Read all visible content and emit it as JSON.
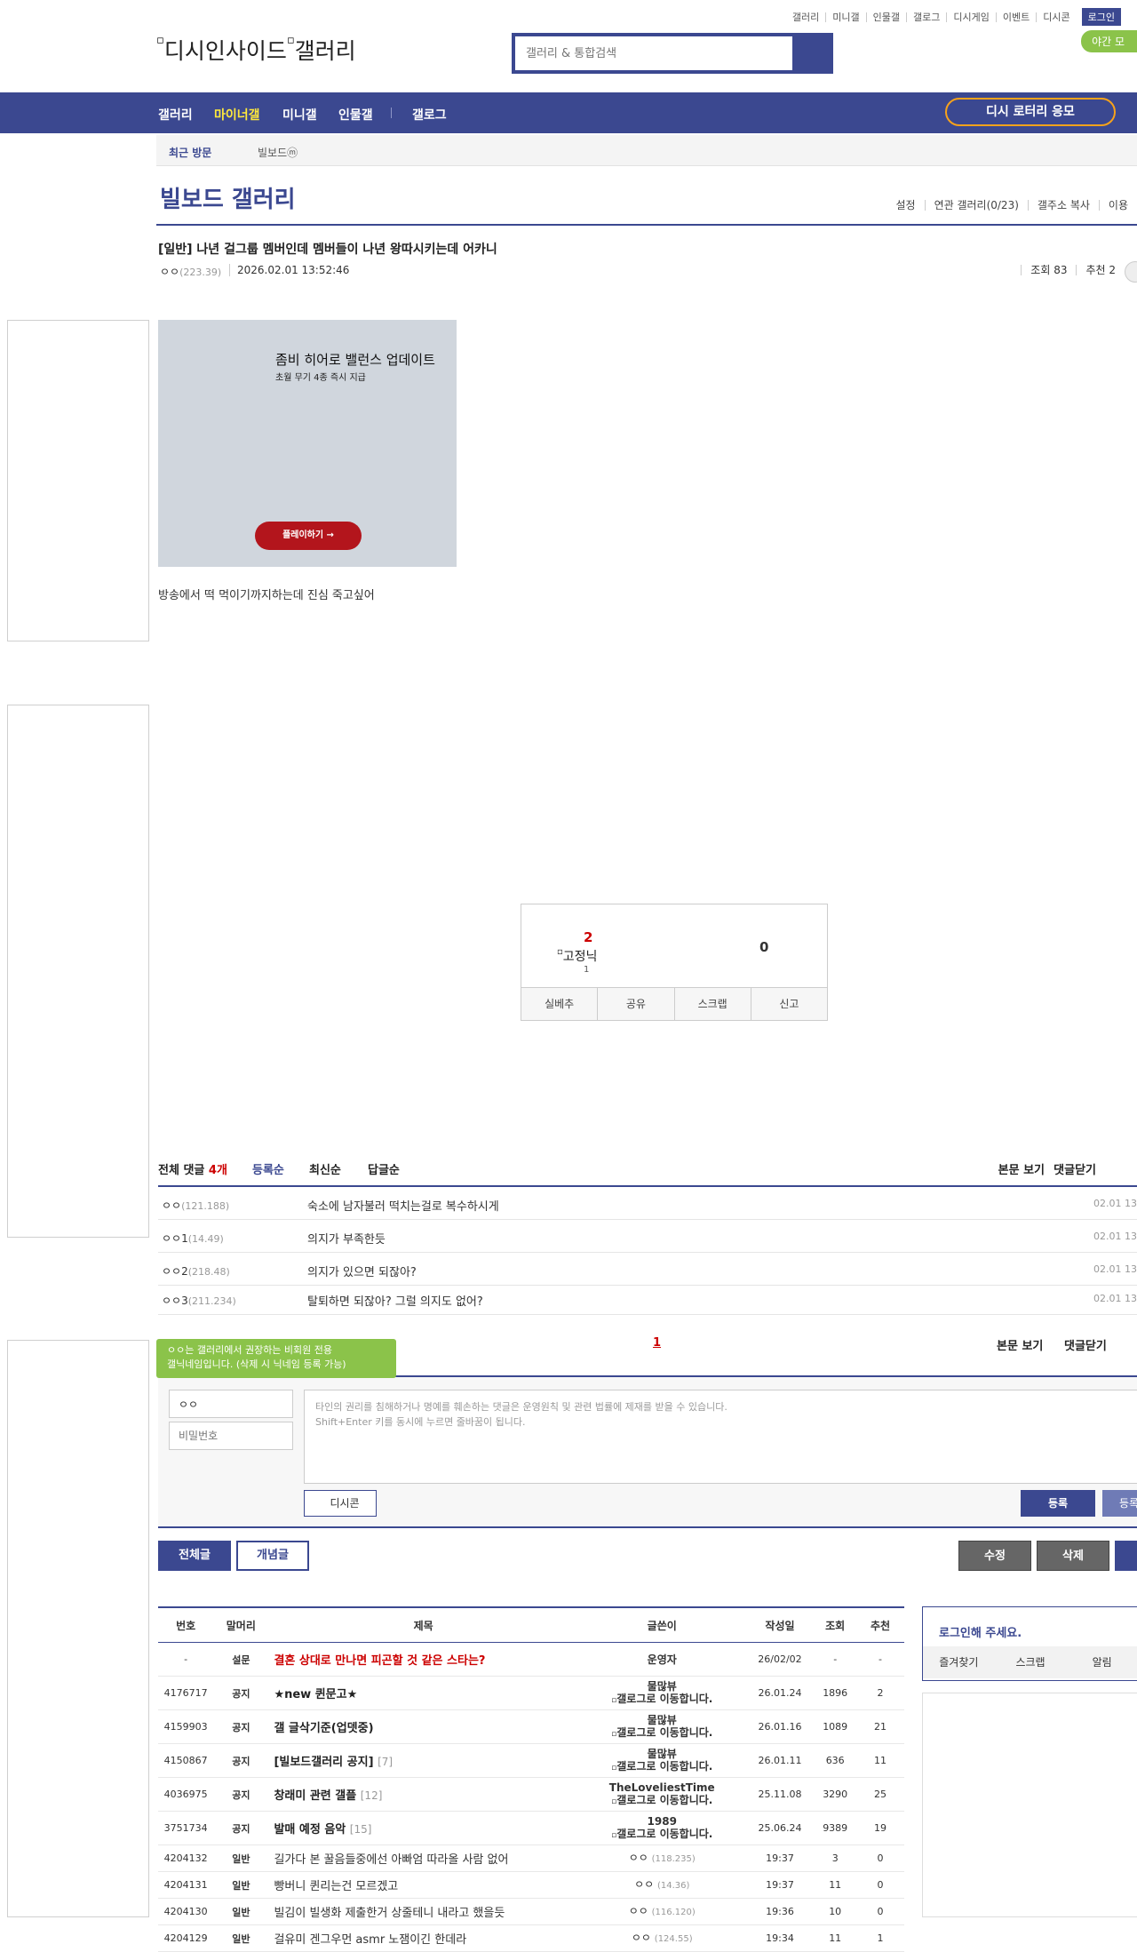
{
  "top_links": [
    "갤러리",
    "미니갤",
    "인물갤",
    "갤로그",
    "디시게임",
    "이벤트",
    "디시콘"
  ],
  "login_label": "로그인",
  "night_mode_label": "야간 모",
  "logo": {
    "alt1": "디시인사이드",
    "alt2": "갤러리"
  },
  "search": {
    "placeholder": "갤러리 & 통합검색"
  },
  "nav": {
    "items": [
      "갤러리",
      "마이너갤",
      "미니갤",
      "인물갤",
      "갤로그"
    ],
    "active_index": 1,
    "lotto": "디시 로터리 응모"
  },
  "recent": {
    "label": "최근 방문",
    "item": "빌보드ⓜ"
  },
  "gallery": {
    "title": "빌보드 갤러리",
    "tools": [
      "설정",
      "연관 갤러리(0/23)",
      "갤주소 복사",
      "이용"
    ]
  },
  "post": {
    "title": "[일반] 나년 걸그룹 멤버인데 멤버들이 나년 왕따시키는데 어카니",
    "writer": "ㅇㅇ",
    "writer_ip": "(223.39)",
    "date": "2026.02.01 13:52:46",
    "views": "조회 83",
    "recommends": "추천 2",
    "body": "방송에서 떡 먹이기까지하는데 진심 죽고싶어"
  },
  "ad": {
    "title": "좀비 히어로 밸런스 업데이트",
    "subtitle": "초월 무기 4종 즉시 지급",
    "button": "플레이하기 →"
  },
  "recommend_box": {
    "up_count": "2",
    "fix_alt": "고정닉",
    "fix_count": "1",
    "down_count": "0",
    "actions": [
      "실베추",
      "공유",
      "스크랩",
      "신고"
    ]
  },
  "comments": {
    "total_label": "전체 댓글",
    "count": "4개",
    "sort": [
      "등록순",
      "최신순",
      "답글순"
    ],
    "view_label": "본문 보기",
    "close_label": "댓글닫기",
    "items": [
      {
        "writer": "ㅇㅇ",
        "ip": "(121.188)",
        "text": "숙소에 남자불러 떡치는걸로 복수하시게",
        "date": "02.01 13"
      },
      {
        "writer": "ㅇㅇ1",
        "ip": "(14.49)",
        "text": "의지가 부족한듯",
        "date": "02.01 13"
      },
      {
        "writer": "ㅇㅇ2",
        "ip": "(218.48)",
        "text": "의지가 있으면 되잖아?",
        "date": "02.01 13"
      },
      {
        "writer": "ㅇㅇ3",
        "ip": "(211.234)",
        "text": "탈퇴하면 되잖아? 그럴 의지도 없어?",
        "date": "02.01 13"
      }
    ],
    "page": "1"
  },
  "write": {
    "tooltip_line1": "ㅇㅇ는 갤러리에서 권장하는 비회원 전용",
    "tooltip_line2": "갤닉네임입니다. (삭제 시 닉네임 등록 가능)",
    "nick": "ㅇㅇ",
    "password_placeholder": "비밀번호",
    "notice_line1": "타인의 권리를 침해하거나 명예를 훼손하는 댓글은 운영원칙 및 관련 법률에 제재를 받을 수 있습니다.",
    "notice_line2": "Shift+Enter 키를 동시에 누르면 줄바꿈이 됩니다.",
    "dccon": "디시콘",
    "submit": "등록",
    "submit2": "등록"
  },
  "list_buttons": {
    "all": "전체글",
    "concept": "개념글",
    "edit": "수정",
    "delete": "삭제"
  },
  "table": {
    "headers": [
      "번호",
      "말머리",
      "제목",
      "글쓴이",
      "작성일",
      "조회",
      "추천"
    ],
    "rows": [
      {
        "no": "-",
        "head": "설문",
        "subject": "결혼 상대로 만나면 피곤할 것 같은 스타는?",
        "reply": "",
        "writer": "운영자",
        "writer2": "",
        "date": "26/02/02",
        "views": "-",
        "rec": "-",
        "type": "survey"
      },
      {
        "no": "4176717",
        "head": "공지",
        "subject": "★new 퀸문고★",
        "reply": "",
        "writer": "물많뷰",
        "writer2": "갤로그로 이동합니다.",
        "date": "26.01.24",
        "views": "1896",
        "rec": "2",
        "type": "notice"
      },
      {
        "no": "4159903",
        "head": "공지",
        "subject": "갤 글삭기준(업뎃중)",
        "reply": "",
        "writer": "물많뷰",
        "writer2": "갤로그로 이동합니다.",
        "date": "26.01.16",
        "views": "1089",
        "rec": "21",
        "type": "notice"
      },
      {
        "no": "4150867",
        "head": "공지",
        "subject": "[빌보드갤러리 공지]",
        "reply": "[7]",
        "writer": "물많뷰",
        "writer2": "갤로그로 이동합니다.",
        "date": "26.01.11",
        "views": "636",
        "rec": "11",
        "type": "notice"
      },
      {
        "no": "4036975",
        "head": "공지",
        "subject": "창래미 관련 갤플",
        "reply": "[12]",
        "writer": "TheLoveliestTime",
        "writer2": "갤로그로 이동합니다.",
        "date": "25.11.08",
        "views": "3290",
        "rec": "25",
        "type": "notice"
      },
      {
        "no": "3751734",
        "head": "공지",
        "subject": "발매 예정 음악",
        "reply": "[15]",
        "writer": "1989",
        "writer2": "갤로그로 이동합니다.",
        "date": "25.06.24",
        "views": "9389",
        "rec": "19",
        "type": "notice"
      },
      {
        "no": "4204132",
        "head": "일반",
        "subject": "길가다 본 꿀음들중에선 아빠엄 따라올 사람 없어",
        "reply": "",
        "writer": "ㅇㅇ",
        "writer2": "(118.235)",
        "date": "19:37",
        "views": "3",
        "rec": "0",
        "type": "general"
      },
      {
        "no": "4204131",
        "head": "일반",
        "subject": "빵버니 퀸리는건 모르겠고",
        "reply": "",
        "writer": "ㅇㅇ",
        "writer2": "(14.36)",
        "date": "19:37",
        "views": "11",
        "rec": "0",
        "type": "general"
      },
      {
        "no": "4204130",
        "head": "일반",
        "subject": "빌김이 빌생화 제출한거 상줄테니 내라고 했을듯",
        "reply": "",
        "writer": "ㅇㅇ",
        "writer2": "(116.120)",
        "date": "19:36",
        "views": "10",
        "rec": "0",
        "type": "general"
      },
      {
        "no": "4204129",
        "head": "일반",
        "subject": "걸유미 겐그우먼 asmr 노잼이긴 한데라",
        "reply": "",
        "writer": "ㅇㅇ",
        "writer2": "(124.55)",
        "date": "19:34",
        "views": "11",
        "rec": "1",
        "type": "general"
      }
    ]
  },
  "login_box": {
    "title": "로그인해 주세요.",
    "links": [
      "즐겨찾기",
      "스크랩",
      "알림"
    ]
  }
}
